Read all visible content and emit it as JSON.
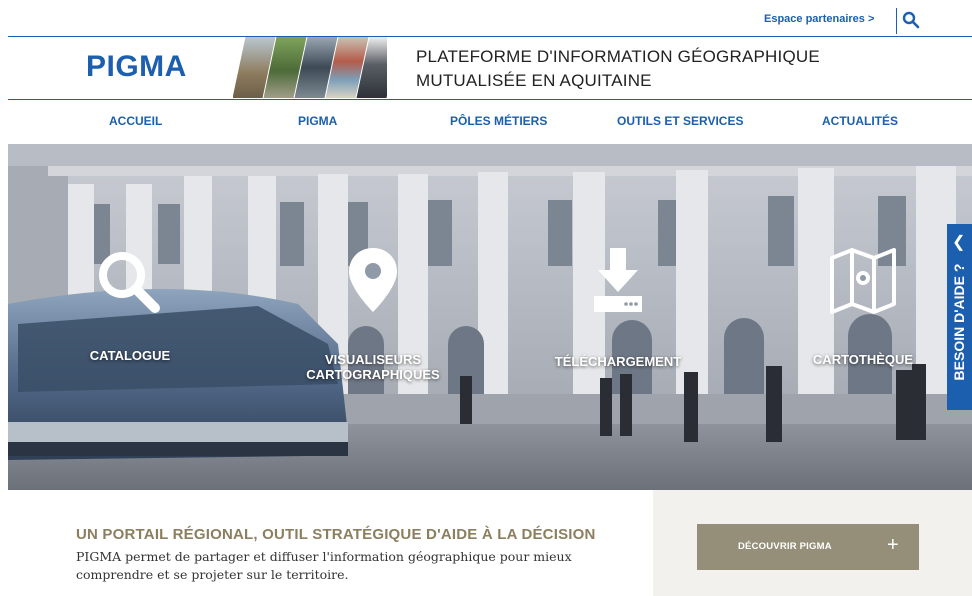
{
  "topbar": {
    "partner_link": "Espace partenaires >",
    "search_icon": "search-icon"
  },
  "header": {
    "logo": "PIGMA",
    "tagline_line1": "PLATEFORME D'INFORMATION GÉOGRAPHIQUE",
    "tagline_line2": "MUTUALISÉE EN AQUITAINE"
  },
  "nav": [
    "ACCUEIL",
    "PIGMA",
    "PÔLES MÉTIERS",
    "OUTILS ET SERVICES",
    "ACTUALITÉS"
  ],
  "services": [
    {
      "label": "CATALOGUE",
      "icon": "magnifier-icon"
    },
    {
      "label_line1": "VISUALISEURS",
      "label_line2": "CARTOGRAPHIQUES",
      "icon": "map-pin-icon"
    },
    {
      "label": "TÉLÉCHARGEMENT",
      "icon": "download-icon"
    },
    {
      "label": "CARTOTHÈQUE",
      "icon": "folded-map-icon"
    }
  ],
  "help_tab": {
    "label": "BESOIN D'AIDE ?",
    "icon": "arrow-left-icon"
  },
  "intro": {
    "title": "UN PORTAIL RÉGIONAL, OUTIL STRATÉGIQUE D'AIDE À LA DÉCISION",
    "text": "PIGMA permet de partager et diffuser l'information géographique pour mieux comprendre et se projeter sur le territoire."
  },
  "cta": {
    "label": "DÉCOUVRIR PIGMA",
    "plus": "+"
  },
  "colors": {
    "brand_blue": "#1c5fae",
    "accent_olive": "#8c7f5f",
    "button_olive": "#958f79",
    "panel_bg": "#f2f1ed"
  }
}
